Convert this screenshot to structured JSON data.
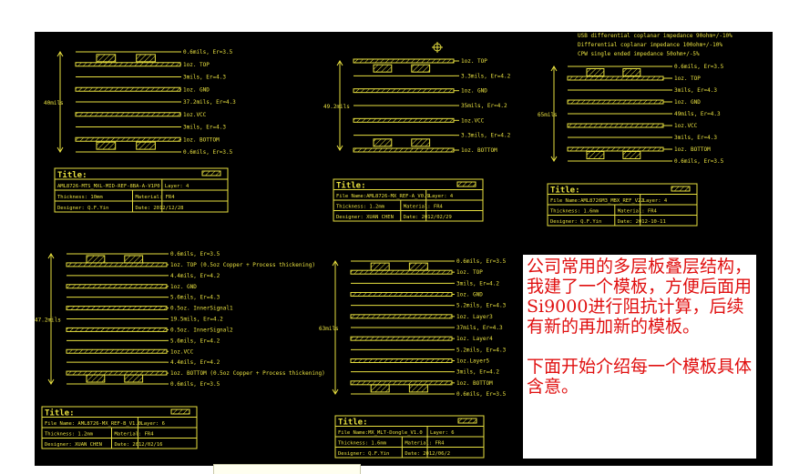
{
  "header_notes": [
    "USB differential coplanar impedance 90ohm+/-10%",
    "Differential coplanar impedance 100ohm+/-10%",
    "CPW single ended impedance 50ohm+/-5%"
  ],
  "panels": [
    {
      "id": "p1",
      "dimension": "40mils",
      "layers": [
        "0.6mils, Er=3.5",
        "1oz. TOP",
        "3mils, Er=4.3",
        "1oz. GND",
        "37.2mils, Er=4.3",
        "1oz.VCC",
        "3mils, Er=4.3",
        "1oz. BOTTOM",
        "0.6mils, Er=3.5"
      ],
      "title_block": {
        "title": "Title:",
        "file": "AML8726-MTS_MXL-MID-REF-8BA-A-V1P0",
        "layer": "Layer: 4",
        "thickness": "Thickness: 10mm",
        "material": "Material: FR4",
        "designer": "Designer: Q.F.Yin",
        "date": "Date: 2012/12/28"
      }
    },
    {
      "id": "p2",
      "dimension": "49.2mils",
      "layers": [
        "1oz. TOP",
        "3.3mils, Er=4.2",
        "1oz. GND",
        "35mils, Er=4.2",
        "1oz.VCC",
        "3.3mils, Er=4.2",
        "1oz. BOTTOM"
      ],
      "title_block": {
        "title": "Title:",
        "file": "File Name:AML8726-MX_REF-A_V0.9",
        "layer": "Layer: 4",
        "thickness": "Thickness: 1.2mm",
        "material": "Material: FR4",
        "designer": "Designer: XUAN CHEN",
        "date": "Date: 2012/02/29"
      }
    },
    {
      "id": "p3",
      "dimension": "65mils",
      "layers": [
        "0.6mils, Er=3.5",
        "1oz. TOP",
        "3mils, Er=4.3",
        "1oz. GND",
        "49mils, Er=4.3",
        "1oz.VCC",
        "3mils, Er=4.3",
        "1oz. BOTTOM",
        "0.6mils, Er=3.5"
      ],
      "title_block": {
        "title": "Title:",
        "file": "File Name:AML8726M3_MBX_REF_V22",
        "layer": "Layer: 4",
        "thickness": "Thickness: 1.6mm",
        "material": "Material: FR4",
        "designer": "Designer: Q.F.Yin",
        "date": "Date: 2012-10-11"
      }
    },
    {
      "id": "p4",
      "dimension": "47.2mils",
      "layers": [
        "0.6mils, Er=3.5",
        "1oz. TOP (0.5oz Copper + Process thickening)",
        "4.4mils, Er=4.2",
        "1oz. GND",
        "5.6mils, Er=4.3",
        "0.5oz. InnerSignal1",
        "19.5mils, Er=4.2",
        "0.5oz. InnerSignal2",
        "5.6mils, Er=4.2",
        "1oz.VCC",
        "4.4mils, Er=4.2",
        "1oz. BOTTOM (0.5oz Copper + Process thickening)",
        "0.6mils, Er=3.5"
      ],
      "title_block": {
        "title": "Title:",
        "file": "File Name: AML8726-MX_REF-B_V1.0",
        "layer": "Layer: 6",
        "thickness": "Thickness: 1.2mm",
        "material": "Material: FR4",
        "designer": "Designer: XUAN CHEN",
        "date": "Date: 2012/02/16"
      }
    },
    {
      "id": "p5",
      "dimension": "63mils",
      "layers": [
        "0.6mils, Er=3.5",
        "1oz. TOP",
        "3mils, Er=4.2",
        "1oz. GND",
        "5.2mils, Er=4.3",
        "1oz. Layer3",
        "37mils, Er=4.3",
        "1oz. Layer4",
        "5.2mils, Er=4.3",
        "1oz.Layer5",
        "3mils, Er=4.2",
        "1oz. BOTTOM",
        "0.6mils, Er=3.5"
      ],
      "title_block": {
        "title": "Title:",
        "file": "File Name:MX_MLT-Dongle_V1.0",
        "layer": "Layer: 6",
        "thickness": "Thickness: 1.6mm",
        "material": "Material: FR4",
        "designer": "Designer: Q.F.Yin",
        "date": "Date: 2012/06/2"
      }
    }
  ],
  "note": {
    "paragraph1": "公司常用的多层板叠层结构，我建了一个模板，方便后面用Si9000进行阻抗计算，后续有新的再加新的模板。",
    "paragraph2": "下面开始介绍每一个模板具体含意。"
  },
  "colors": {
    "background": "#000000",
    "lines": "#e8e040",
    "note_text": "#e01010"
  }
}
